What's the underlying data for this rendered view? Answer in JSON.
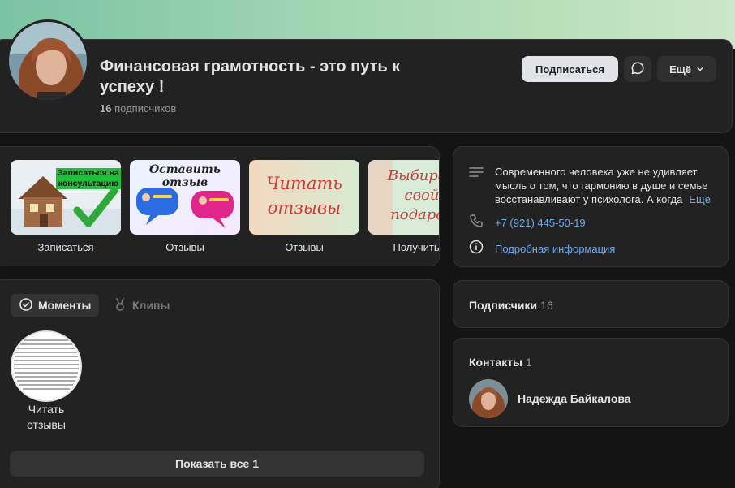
{
  "group": {
    "title": "Финансовая грамотность - это путь к успеху !",
    "subscribers_count": "16",
    "subscribers_word": "подписчиков"
  },
  "header_buttons": {
    "subscribe": "Подписаться",
    "more": "Ещё"
  },
  "links": [
    {
      "label": "Записаться",
      "thumb_text": "Записаться на консультацию"
    },
    {
      "label": "Отзывы",
      "thumb_text": "Оставить отзыв"
    },
    {
      "label": "Отзывы",
      "thumb_text": "Читать отзывы"
    },
    {
      "label": "Получить по",
      "thumb_text": "Выбирай свой подарок"
    }
  ],
  "info": {
    "description": "Современного человека уже не удивляет мысль о том, что гармонию в душе и семье восстанавливают у психолога. А когда",
    "more": "Ещё",
    "phone": "+7 (921) 445-50-19",
    "details_link": "Подробная информация"
  },
  "moments": {
    "tab_active": "Моменты",
    "tab_inactive": "Клипы",
    "item_label": "Читать отзывы",
    "show_all": "Показать все 1"
  },
  "subscribers_section": {
    "title": "Подписчики",
    "count": "16"
  },
  "contacts": {
    "title": "Контакты",
    "count": "1",
    "items": [
      {
        "name": "Надежда Байкалова"
      }
    ]
  },
  "colors": {
    "background": "#141414",
    "card": "#222222",
    "accent_link": "#71aaeb",
    "cover_start": "#79c3a3",
    "cover_end": "#cbe7c8"
  }
}
